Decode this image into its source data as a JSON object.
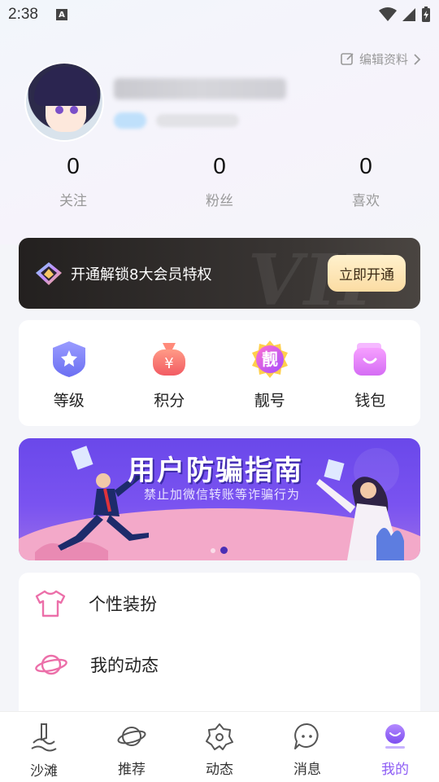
{
  "status_bar": {
    "time": "2:38",
    "a_badge": "A"
  },
  "header": {
    "edit_profile": "编辑资料"
  },
  "stats": [
    {
      "value": "0",
      "label": "关注"
    },
    {
      "value": "0",
      "label": "粉丝"
    },
    {
      "value": "0",
      "label": "喜欢"
    }
  ],
  "vip": {
    "text": "开通解锁8大会员特权",
    "button": "立即开通",
    "watermark": "VIP"
  },
  "features": [
    {
      "label": "等级",
      "icon": "level-badge-icon"
    },
    {
      "label": "积分",
      "icon": "points-bag-icon"
    },
    {
      "label": "靓号",
      "icon": "pretty-number-icon",
      "glyph": "靓"
    },
    {
      "label": "钱包",
      "icon": "wallet-icon"
    }
  ],
  "banner": {
    "title": "用户防骗指南",
    "subtitle": "禁止加微信转账等诈骗行为"
  },
  "menu": [
    {
      "label": "个性装扮",
      "icon": "tshirt-icon"
    },
    {
      "label": "我的动态",
      "icon": "planet-icon"
    }
  ],
  "tabs": [
    {
      "label": "沙滩",
      "icon": "beach-icon"
    },
    {
      "label": "推荐",
      "icon": "planet-icon"
    },
    {
      "label": "动态",
      "icon": "flower-icon"
    },
    {
      "label": "消息",
      "icon": "chat-bubble-icon"
    },
    {
      "label": "我的",
      "icon": "profile-icon",
      "active": true
    }
  ],
  "colors": {
    "accent": "#8d5cf5",
    "vip_gold": "#fbdca3",
    "banner_purple": "#6a48ea"
  }
}
